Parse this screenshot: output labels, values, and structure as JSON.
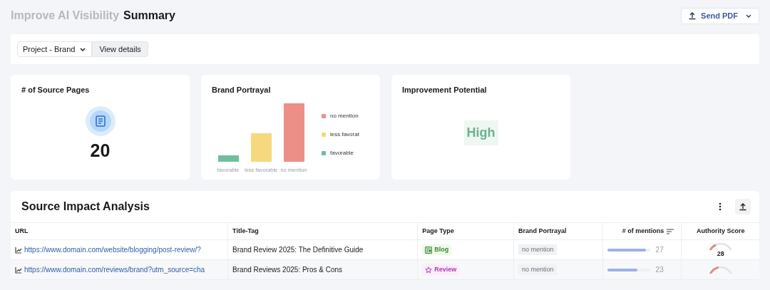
{
  "header": {
    "breadcrumb": "Improve AI Visibility",
    "title": "Summary",
    "send_button": "Send PDF"
  },
  "filters": {
    "project_select": "Project - Brand",
    "details_button": "View details"
  },
  "cards": {
    "source_pages": {
      "title": "# of Source Pages",
      "value": "20"
    },
    "brand_portrayal": {
      "title": "Brand Portrayal",
      "categories": [
        "favorable",
        "less favorable",
        "no mention"
      ],
      "legend": [
        {
          "label": "no mention",
          "color": "#ec8f86"
        },
        {
          "label": "less favorat",
          "color": "#f6d87e"
        },
        {
          "label": "favorable",
          "color": "#6fbf9c"
        }
      ]
    },
    "improvement": {
      "title": "Improvement Potential",
      "value": "High"
    }
  },
  "table": {
    "title": "Source Impact Analysis",
    "columns": [
      "URL",
      "Title-Tag",
      "Page Type",
      "Brand Portrayal",
      "# of mentions",
      "Authority Score"
    ],
    "rows": [
      {
        "url": "https://www.domain.com/website/blogging/post-review/?",
        "title_tag": "Brand Review 2025: The Definitive Guide",
        "page_type": {
          "kind": "blog",
          "label": "Blog"
        },
        "portrayal": "no mention",
        "mentions": {
          "level": 0.9,
          "value": "27"
        },
        "authority": {
          "level": 0.28,
          "value": "28"
        }
      },
      {
        "url": "https://www.domain.com/reviews/brand?utm_source=cha",
        "title_tag": "Brand Reviews 2025: Pros & Cons",
        "page_type": {
          "kind": "review",
          "label": "Review"
        },
        "portrayal": "no mention",
        "mentions": {
          "level": 0.7,
          "value": "23"
        },
        "authority": {
          "level": 0.4
        }
      }
    ]
  }
}
